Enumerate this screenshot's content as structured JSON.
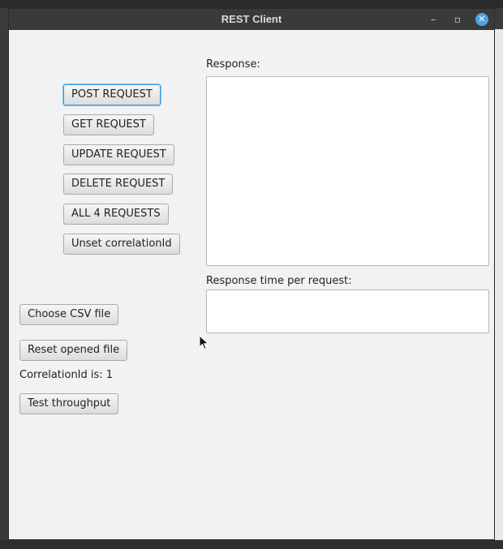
{
  "window": {
    "title": "REST Client",
    "minimize_icon": "–",
    "maximize_icon": "▫",
    "close_icon": "✕"
  },
  "request_buttons": {
    "post": "POST REQUEST",
    "get": "GET REQUEST",
    "update": "UPDATE REQUEST",
    "delete": "DELETE REQUEST",
    "all": "ALL 4 REQUESTS",
    "unset_correlation": "Unset correlationId"
  },
  "file_controls": {
    "choose_csv": "Choose CSV file",
    "reset_file": "Reset opened file",
    "correlation_text": "CorrelationId is: 1",
    "test_throughput": "Test throughput"
  },
  "response": {
    "label": "Response:",
    "value": "",
    "time_label": "Response time per request:",
    "time_value": ""
  },
  "colors": {
    "focus_accent": "#3d9de0",
    "titlebar": "#3a3a3a",
    "close_button": "#4aa3df"
  }
}
